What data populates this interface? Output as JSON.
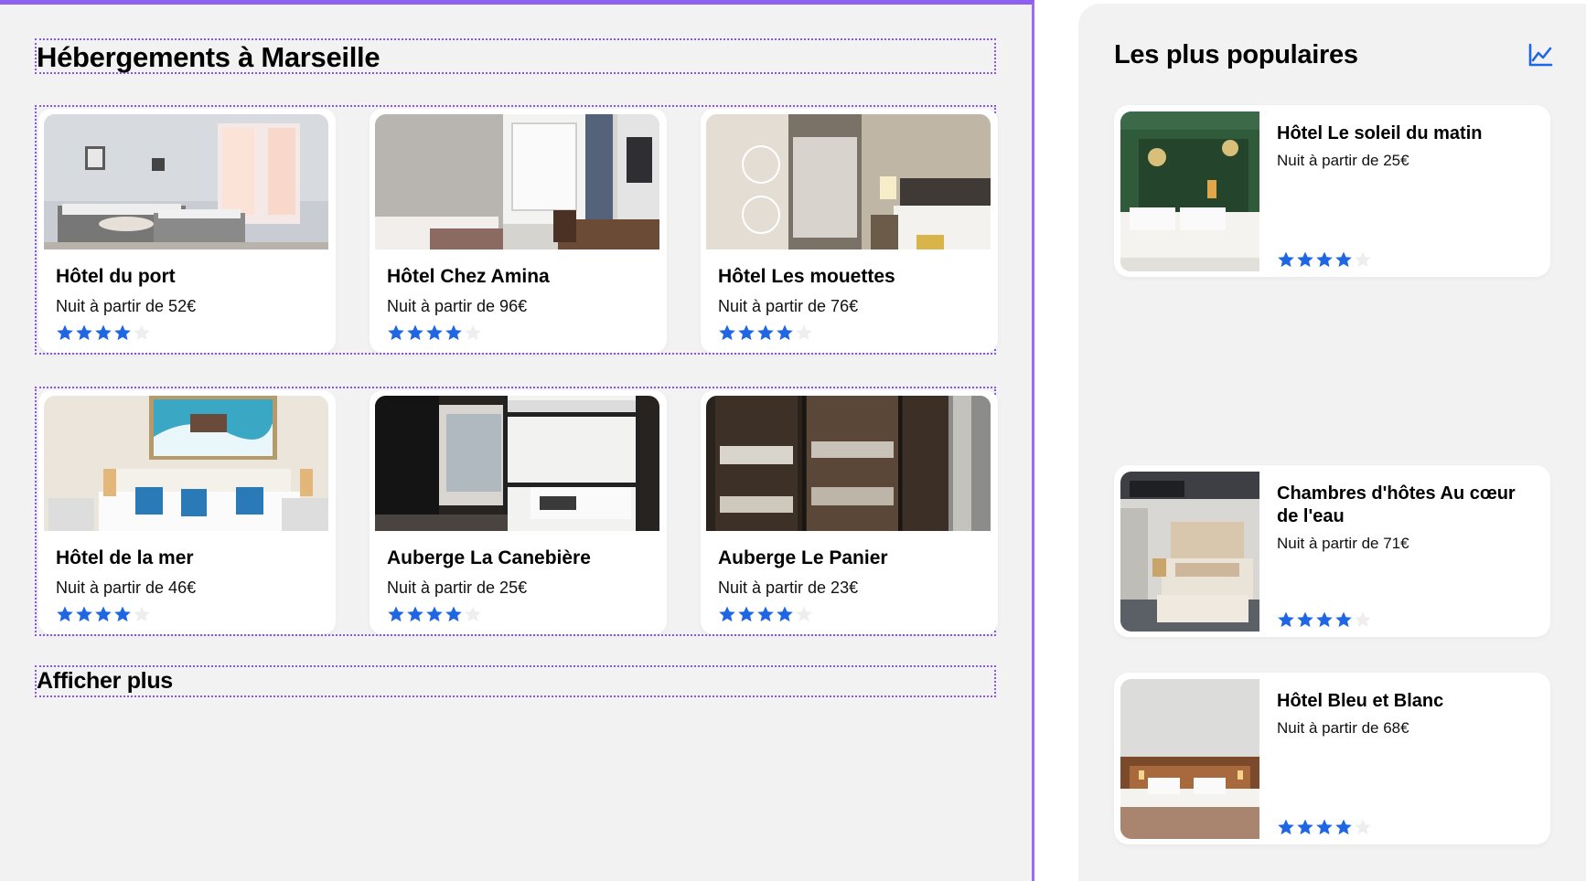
{
  "main": {
    "title": "Hébergements à Marseille",
    "show_more": "Afficher plus",
    "hotels": [
      {
        "name": "Hôtel du port",
        "price": "Nuit à partir de 52€",
        "rating": 4
      },
      {
        "name": "Hôtel Chez Amina",
        "price": "Nuit à partir de 96€",
        "rating": 4
      },
      {
        "name": "Hôtel Les mouettes",
        "price": "Nuit à partir de 76€",
        "rating": 4
      },
      {
        "name": "Hôtel de la mer",
        "price": "Nuit à partir de 46€",
        "rating": 4
      },
      {
        "name": "Auberge La Canebière",
        "price": "Nuit à partir de 25€",
        "rating": 4
      },
      {
        "name": "Auberge Le Panier",
        "price": "Nuit à partir de 23€",
        "rating": 4
      }
    ]
  },
  "sidebar": {
    "title": "Les plus populaires",
    "icon": "trending-chart-icon",
    "items": [
      {
        "name": "Hôtel Le soleil du matin",
        "price": "Nuit à partir de 25€",
        "rating": 4
      },
      {
        "name": "Chambres d'hôtes Au cœur de l'eau",
        "price": "Nuit à partir de 71€",
        "rating": 4
      },
      {
        "name": "Hôtel Bleu et Blanc",
        "price": "Nuit à partir de 68€",
        "rating": 4
      }
    ]
  },
  "colors": {
    "accent": "#8e5ff0",
    "star_filled": "#1f66e5",
    "star_empty": "#eeeeee",
    "background": "#f2f2f2"
  }
}
